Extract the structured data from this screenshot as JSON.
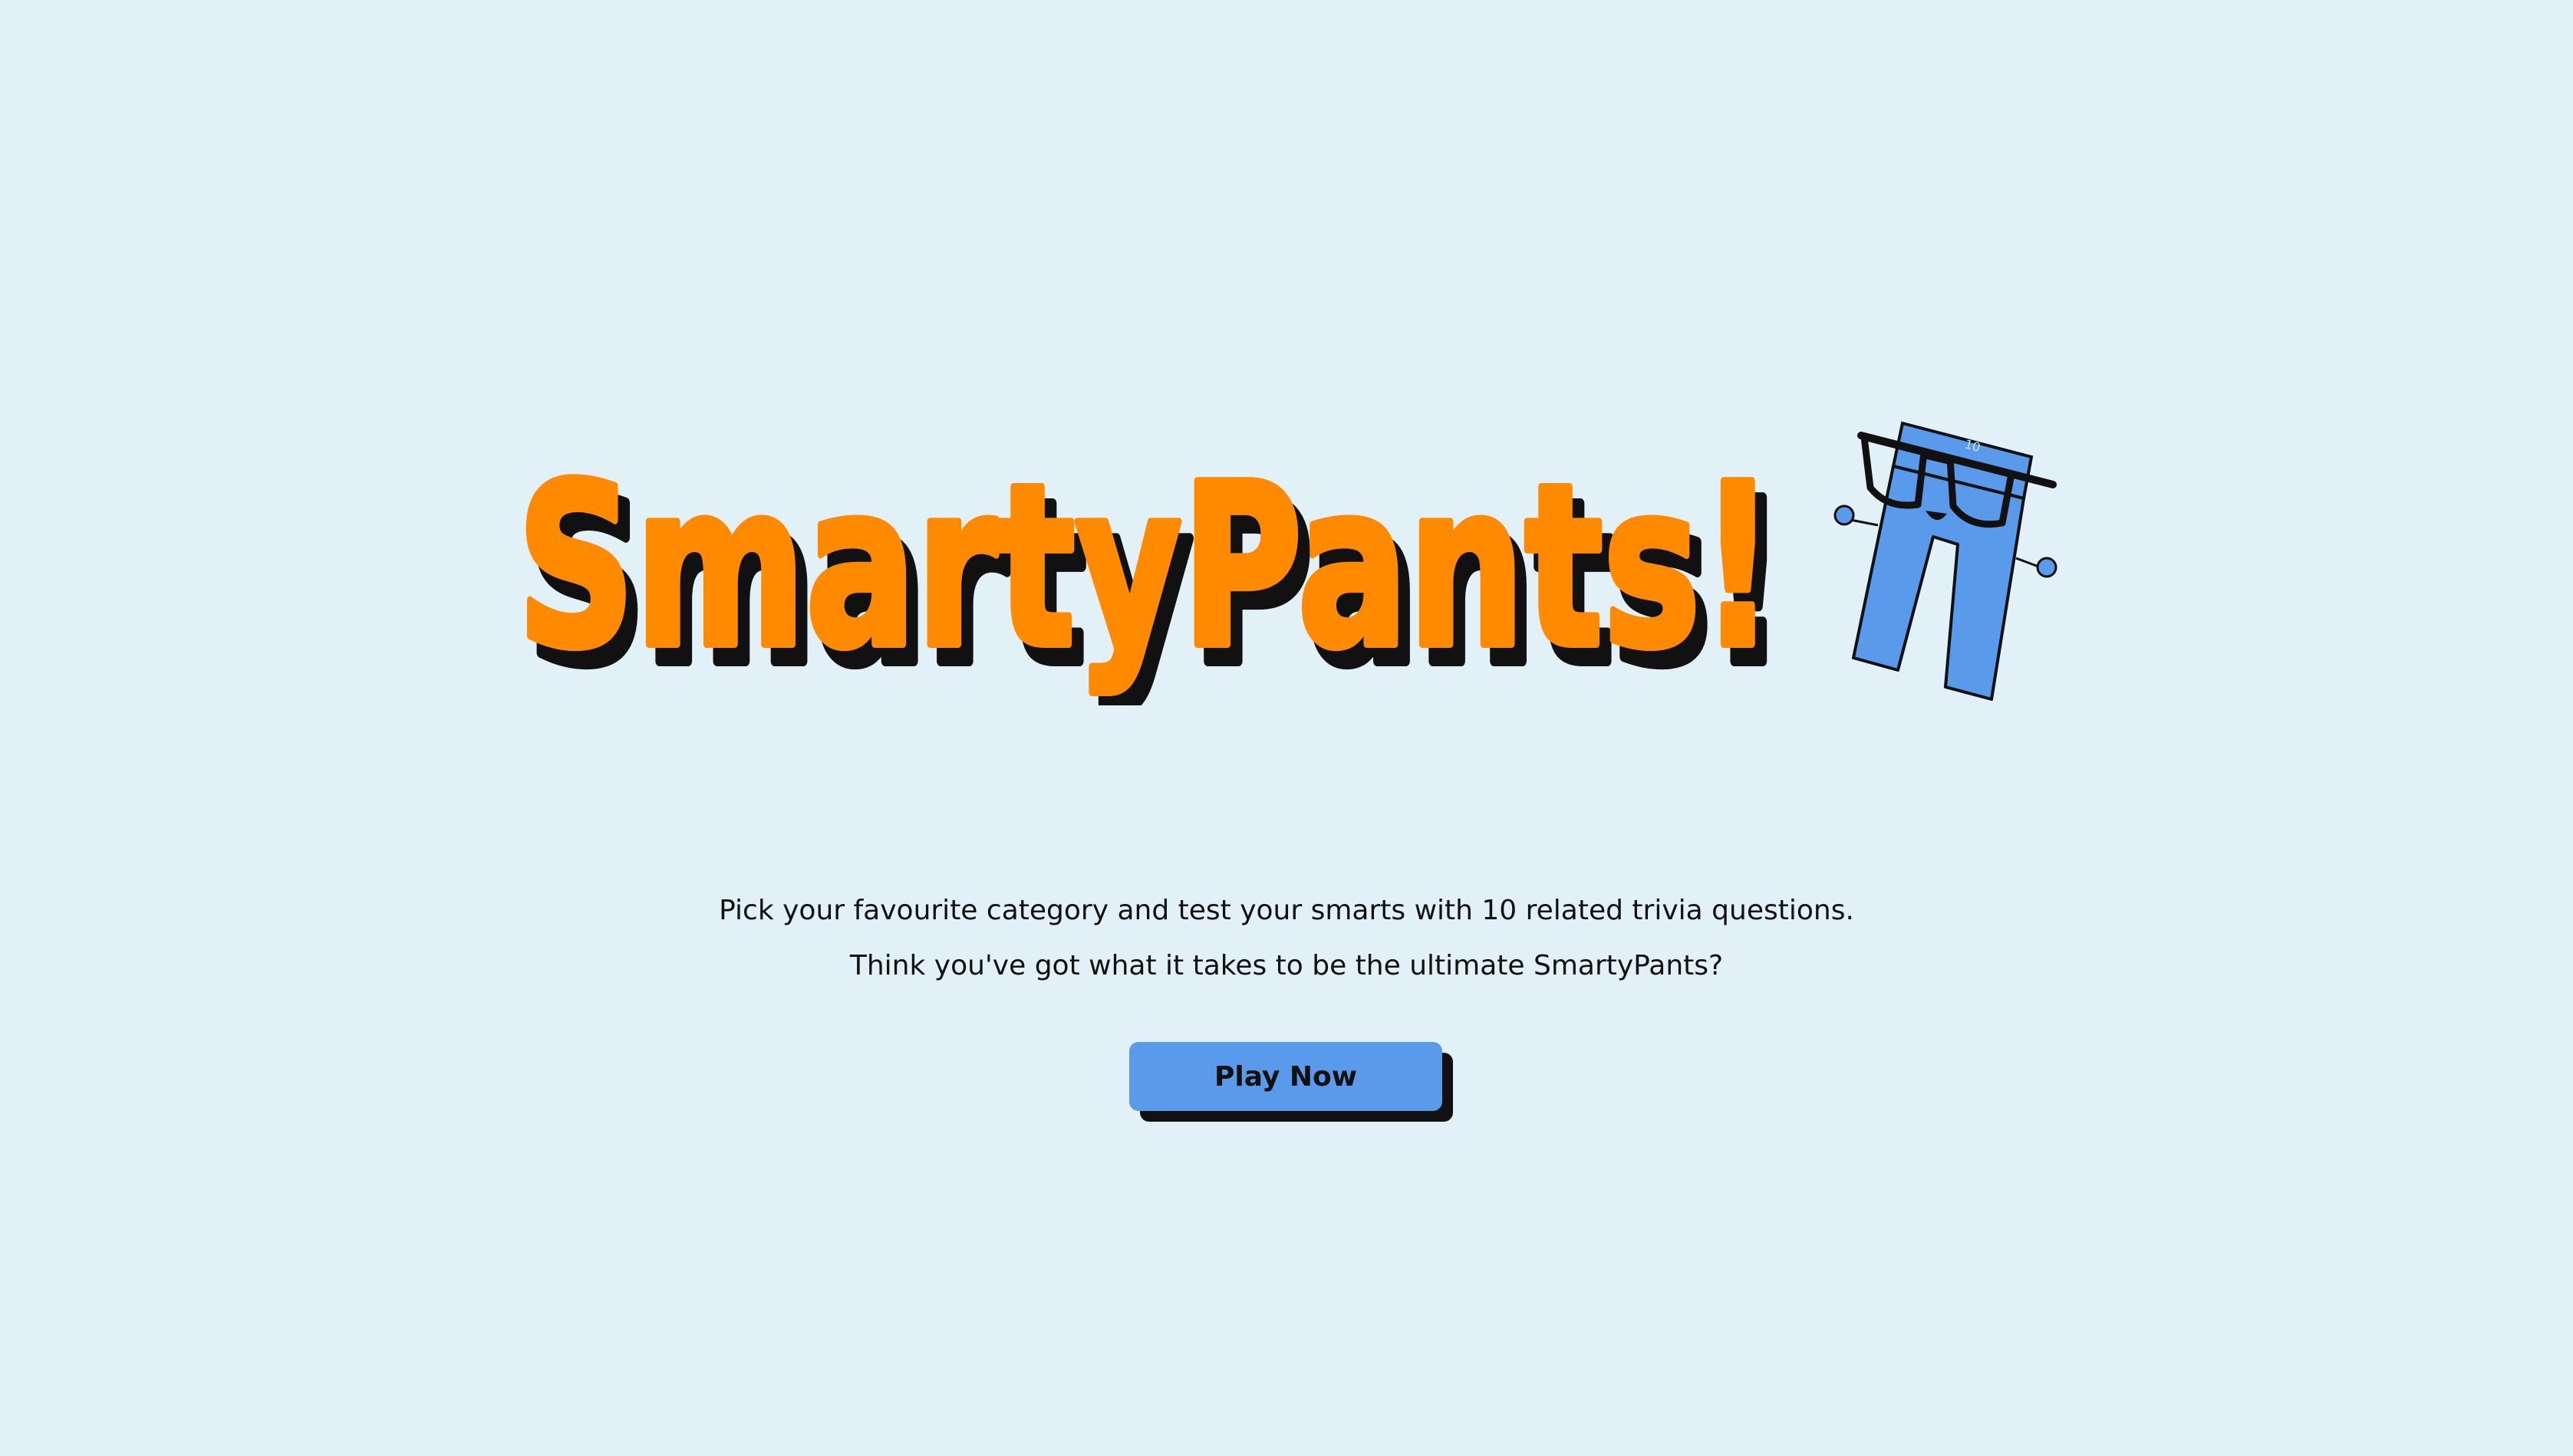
{
  "title": "SmartyPants!",
  "tagline": {
    "line1": "Pick your favourite category and test your smarts with 10 related trivia questions.",
    "line2": "Think you've got what it takes to be the ultimate SmartyPants?"
  },
  "play_button": {
    "label": "Play Now"
  },
  "mascot": {
    "icon": "pants-mascot-with-glasses-icon",
    "waist_label": "10"
  },
  "colors": {
    "background": "#e2f0f8",
    "title_fill": "#ff8a00",
    "title_shadow": "#111111",
    "mascot": "#5a9aea",
    "button": "#5a9aea",
    "text": "#111111"
  }
}
